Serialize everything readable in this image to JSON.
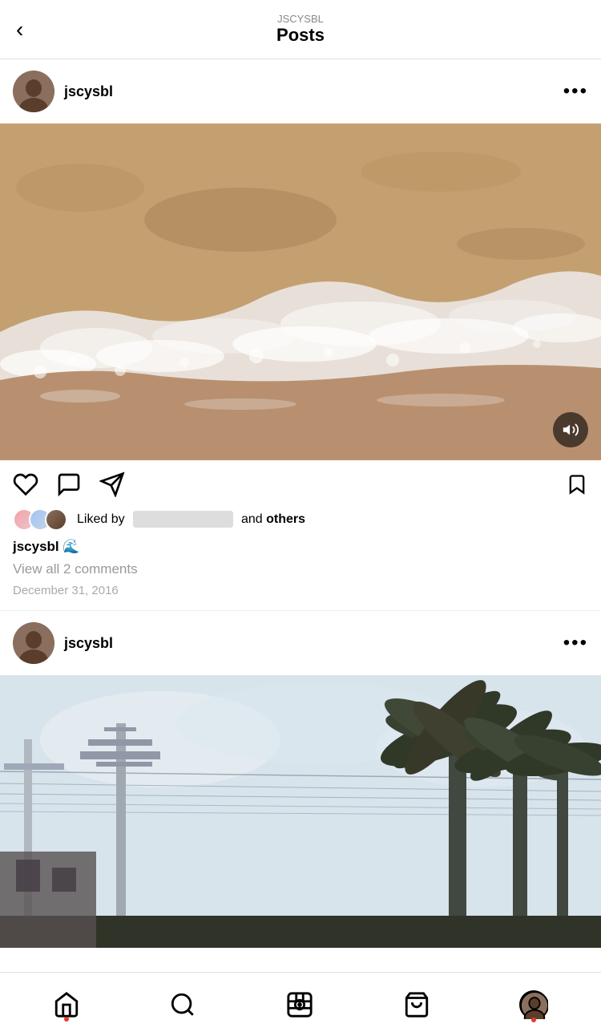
{
  "header": {
    "back_label": "‹",
    "username_small": "JSCYSBL",
    "title": "Posts"
  },
  "post1": {
    "username": "jscysbl",
    "more_icon": "•••",
    "image_alt": "Beach wave on sand",
    "actions": {
      "like_label": "like",
      "comment_label": "comment",
      "share_label": "share",
      "bookmark_label": "bookmark"
    },
    "liked_by_prefix": "Liked by",
    "liked_by_middle": "and",
    "liked_by_suffix": "others",
    "caption_username": "jscysbl",
    "caption_emoji": "🌊",
    "view_comments": "View all 2 comments",
    "date": "December 31, 2016"
  },
  "post2": {
    "username": "jscysbl",
    "more_icon": "•••",
    "image_alt": "Palm trees and power lines"
  },
  "nav": {
    "home_label": "home",
    "search_label": "search",
    "reels_label": "reels",
    "shop_label": "shop",
    "profile_label": "profile"
  }
}
